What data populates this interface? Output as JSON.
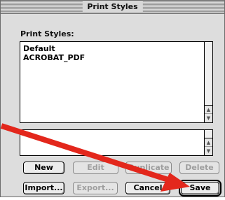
{
  "window": {
    "title": "Print Styles"
  },
  "section": {
    "label": "Print Styles:"
  },
  "styles_list": {
    "items": [
      "Default",
      "ACROBAT_PDF"
    ]
  },
  "buttons": {
    "new": "New",
    "edit": "Edit",
    "duplicate": "Duplicate",
    "delete": "Delete",
    "import": "Import...",
    "export": "Export...",
    "cancel": "Cancel",
    "save": "Save"
  },
  "annotation": {
    "arrow_color": "#e3271c"
  }
}
